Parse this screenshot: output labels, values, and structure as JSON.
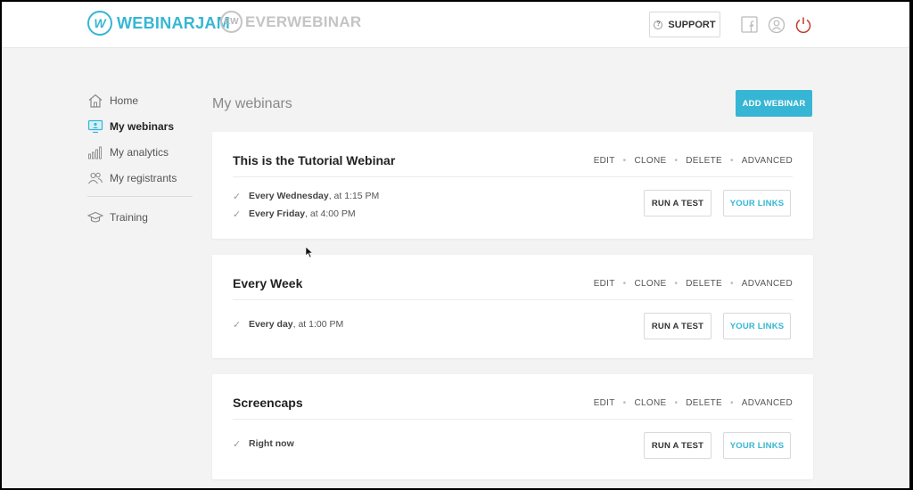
{
  "header": {
    "brand_primary": "WEBINARJAM",
    "brand_primary_mark": "W",
    "brand_secondary": "EVERWEBINAR",
    "brand_secondary_mark": "EW",
    "support_label": "SUPPORT",
    "support_mark": "?",
    "icons": [
      "facebook-icon",
      "user-icon",
      "power-icon"
    ]
  },
  "sidebar": {
    "items": [
      {
        "label": "Home",
        "icon": "home-icon",
        "active": false
      },
      {
        "label": "My webinars",
        "icon": "monitor-icon",
        "active": true
      },
      {
        "label": "My analytics",
        "icon": "bar-chart-icon",
        "active": false
      },
      {
        "label": "My registrants",
        "icon": "users-icon",
        "active": false
      },
      {
        "label": "Training",
        "icon": "graduation-cap-icon",
        "active": false
      }
    ]
  },
  "main": {
    "title": "My webinars",
    "add_label": "ADD WEBINAR",
    "actions": {
      "edit": "EDIT",
      "clone": "CLONE",
      "delete": "DELETE",
      "advanced": "ADVANCED"
    },
    "run_test_label": "RUN A TEST",
    "your_links_label": "YOUR LINKS",
    "webinars": [
      {
        "title": "This is the Tutorial Webinar",
        "schedule": [
          {
            "day": "Every Wednesday",
            "time": ", at 1:15 PM"
          },
          {
            "day": "Every Friday",
            "time": ", at 4:00 PM"
          }
        ]
      },
      {
        "title": "Every Week",
        "schedule": [
          {
            "day": "Every day",
            "time": ", at 1:00 PM"
          }
        ]
      },
      {
        "title": "Screencaps",
        "schedule": [
          {
            "day": "Right now",
            "time": ""
          }
        ]
      }
    ]
  },
  "colors": {
    "accent": "#36b6d4",
    "power": "#c0392b",
    "background": "#f3f3f3"
  }
}
